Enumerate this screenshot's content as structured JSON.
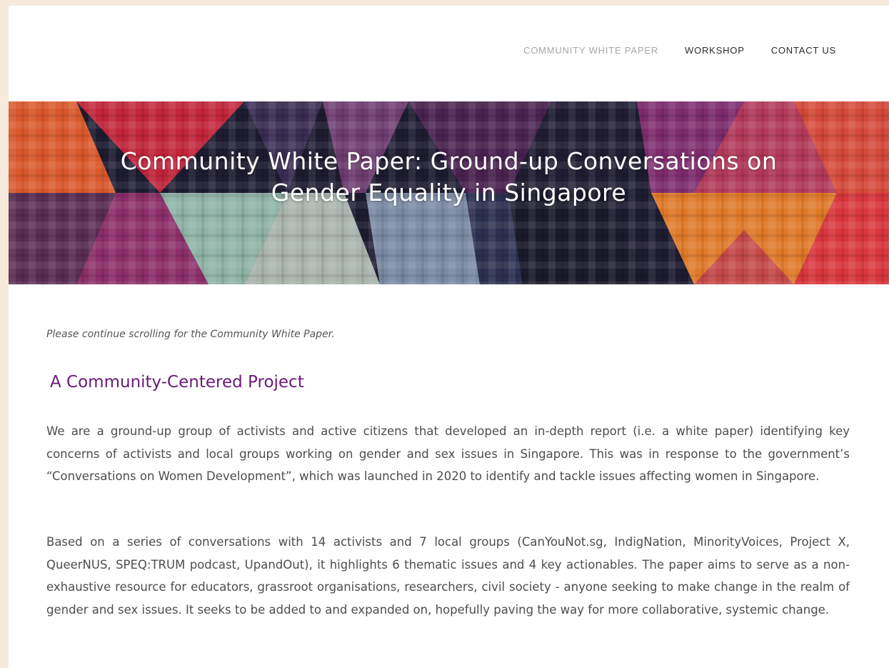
{
  "nav": {
    "items": [
      {
        "label": "COMMUNITY WHITE PAPER",
        "active": true
      },
      {
        "label": "WORKSHOP",
        "active": false
      },
      {
        "label": "CONTACT US",
        "active": false
      }
    ]
  },
  "banner": {
    "title": "Community White Paper: Ground-up Conversations on Gender Equality in Singapore"
  },
  "content": {
    "note": "Please continue scrolling for the Community White Paper.",
    "heading": "A Community-Centered Project",
    "paragraphs": [
      "We are a ground-up group of activists and active citizens that developed an in-depth report (i.e. a white paper) identifying key concerns of activists and local groups working on gender and sex issues in Singapore. This was in response to the government’s “Conversations on Women Development”, which was launched in 2020 to identify and tackle issues affecting women in Singapore.",
      "Based on a series of conversations with 14 activists and 7 local groups (CanYouNot.sg, IndigNation, MinorityVoices, Project X, QueerNUS, SPEQ:TRUM podcast, UpandOut), it highlights 6 thematic issues and 4 key actionables. The paper aims to serve as a non-exhaustive resource for educators, grassroot organisations, researchers, civil society - anyone seeking to make change in the realm of gender and sex issues. It seeks to be added to and expanded on, hopefully paving the way for more collaborative, systemic change."
    ]
  },
  "colors": {
    "page_background": "#f7eadb",
    "heading": "#6a1a78",
    "nav_active": "#a7a7a7",
    "nav_default": "#2b2b2b"
  }
}
